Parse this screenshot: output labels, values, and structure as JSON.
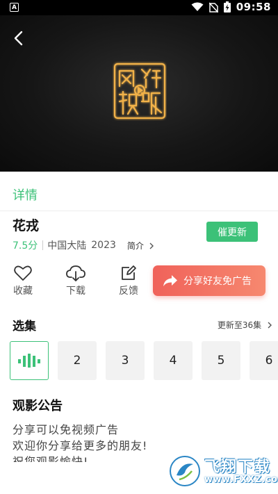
{
  "status_bar": {
    "left_icon": "A",
    "time": "09:58"
  },
  "player": {
    "logo_text": "风行视听"
  },
  "detail": {
    "tab_label": "详情",
    "title": "花戎",
    "score": "7.5分",
    "region": "中国大陆",
    "year": "2023",
    "intro_label": "简介",
    "urge_button": "催更新",
    "actions": {
      "favorite": "收藏",
      "download": "下载",
      "feedback": "反馈"
    },
    "share_button": "分享好友免广告"
  },
  "episodes": {
    "title": "选集",
    "update_text": "更新至36集",
    "items": [
      "2",
      "3",
      "4",
      "5",
      "6"
    ]
  },
  "notice": {
    "title": "观影公告",
    "lines": [
      "分享可以免视频广告",
      "欢迎你分享给更多的朋友!",
      "祝您观影愉快!"
    ]
  },
  "watermark": {
    "text": "飞翔下载",
    "url": "www.FXXZ.com"
  },
  "colors": {
    "accent": "#3cc178",
    "share_gradient_start": "#f0625a",
    "share_gradient_end": "#f6886f"
  }
}
